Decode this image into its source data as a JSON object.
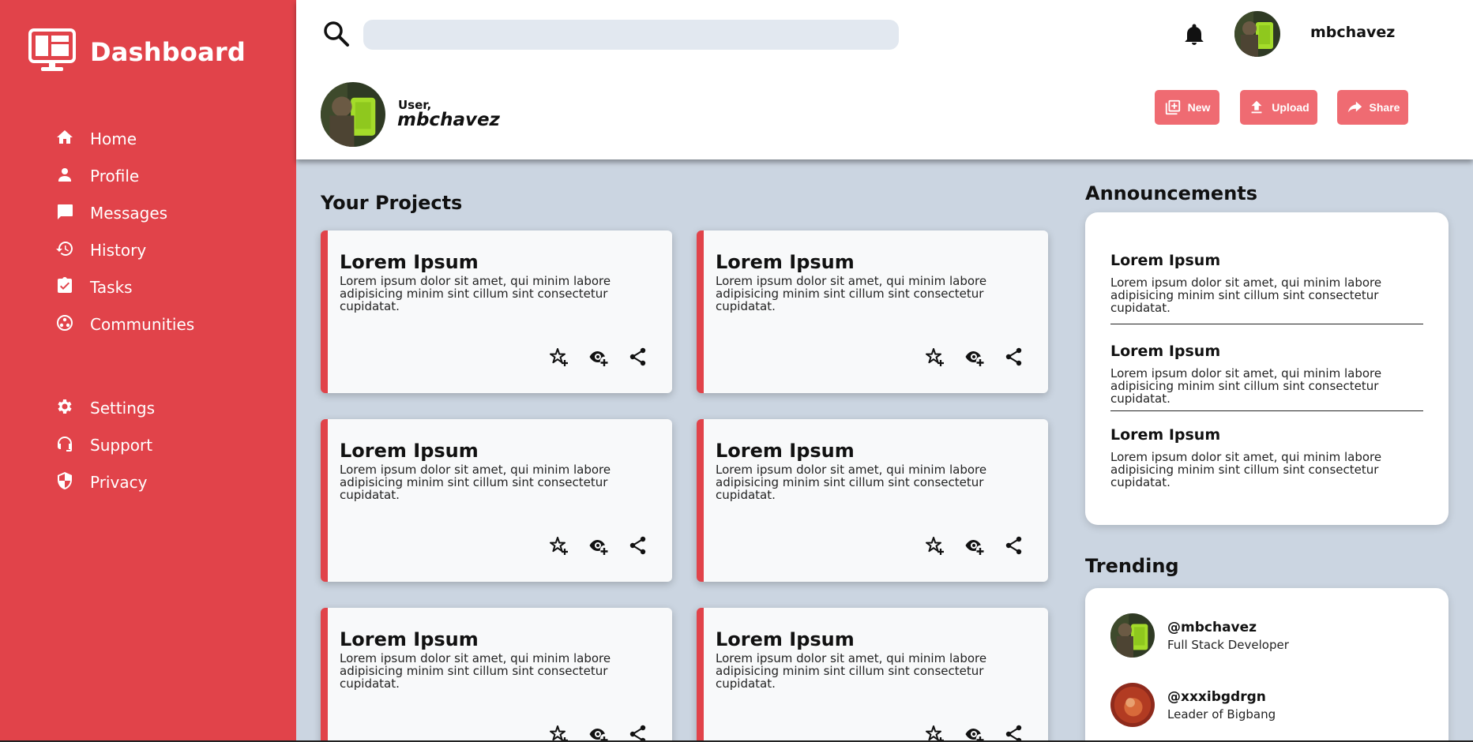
{
  "sidebar": {
    "brand": "Dashboard",
    "primary_nav": [
      {
        "label": "Home",
        "icon": "home-icon"
      },
      {
        "label": "Profile",
        "icon": "user-icon"
      },
      {
        "label": "Messages",
        "icon": "message-icon"
      },
      {
        "label": "History",
        "icon": "history-icon"
      },
      {
        "label": "Tasks",
        "icon": "tasks-icon"
      },
      {
        "label": "Communities",
        "icon": "communities-icon"
      }
    ],
    "secondary_nav": [
      {
        "label": "Settings",
        "icon": "gear-icon"
      },
      {
        "label": "Support",
        "icon": "support-icon"
      },
      {
        "label": "Privacy",
        "icon": "shield-icon"
      }
    ]
  },
  "header": {
    "search": {
      "placeholder": "",
      "value": ""
    },
    "username": "mbchavez",
    "greeting": "User,",
    "profile_name": "mbchavez",
    "buttons": {
      "new": "New",
      "upload": "Upload",
      "share": "Share"
    }
  },
  "projects": {
    "title": "Your Projects",
    "cards": [
      {
        "title": "Lorem Ipsum",
        "text": "Lorem ipsum dolor sit amet, qui minim labore adipisicing minim sint cillum sint consectetur cupidatat."
      },
      {
        "title": "Lorem Ipsum",
        "text": "Lorem ipsum dolor sit amet, qui minim labore adipisicing minim sint cillum sint consectetur cupidatat."
      },
      {
        "title": "Lorem Ipsum",
        "text": "Lorem ipsum dolor sit amet, qui minim labore adipisicing minim sint cillum sint consectetur cupidatat."
      },
      {
        "title": "Lorem Ipsum",
        "text": "Lorem ipsum dolor sit amet, qui minim labore adipisicing minim sint cillum sint consectetur cupidatat."
      },
      {
        "title": "Lorem Ipsum",
        "text": "Lorem ipsum dolor sit amet, qui minim labore adipisicing minim sint cillum sint consectetur cupidatat."
      },
      {
        "title": "Lorem Ipsum",
        "text": "Lorem ipsum dolor sit amet, qui minim labore adipisicing minim sint cillum sint consectetur cupidatat."
      }
    ]
  },
  "announcements": {
    "title": "Announcements",
    "items": [
      {
        "title": "Lorem Ipsum",
        "text": "Lorem ipsum dolor sit amet, qui minim labore adipisicing minim sint cillum sint consectetur cupidatat."
      },
      {
        "title": "Lorem Ipsum",
        "text": "Lorem ipsum dolor sit amet, qui minim labore adipisicing minim sint cillum sint consectetur cupidatat."
      },
      {
        "title": "Lorem Ipsum",
        "text": "Lorem ipsum dolor sit amet, qui minim labore adipisicing minim sint cillum sint consectetur cupidatat."
      }
    ]
  },
  "trending": {
    "title": "Trending",
    "users": [
      {
        "handle": "@mbchavez",
        "role": "Full Stack Developer"
      },
      {
        "handle": "@xxxibgdrgn",
        "role": "Leader of Bigbang"
      }
    ]
  },
  "colors": {
    "sidebar": "#e1434a",
    "accent": "#e1434a",
    "button": "#ef6b72",
    "background": "#cbd5e1",
    "search_bg": "#e2e8f0"
  }
}
